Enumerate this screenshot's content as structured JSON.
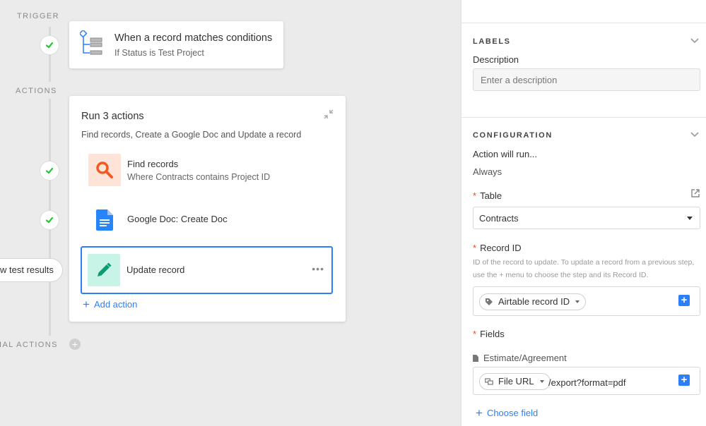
{
  "canvas": {
    "trigger_label": "TRIGGER",
    "actions_label": "ACTIONS",
    "conditional_label": "IAL ACTIONS",
    "trigger": {
      "title": "When a record matches conditions",
      "subtitle": "If Status is Test Project"
    },
    "group": {
      "title": "Run 3 actions",
      "description": "Find records, Create a Google Doc and Update a record",
      "steps": [
        {
          "title": "Find records",
          "subtitle": "Where Contracts contains Project ID",
          "icon": "search-icon"
        },
        {
          "title": "Google Doc: Create Doc",
          "subtitle": "",
          "icon": "google-doc-icon"
        },
        {
          "title": "Update record",
          "subtitle": "",
          "icon": "pencil-icon",
          "selected": true,
          "menu": "•••"
        }
      ],
      "add_action": "Add action"
    },
    "view_results": "w test results",
    "colors": {
      "success": "#20c933",
      "accent": "#2d7ff9",
      "find_bg": "#fde3d8",
      "find_fg": "#f25a1e",
      "update_bg": "#c7f4e6",
      "update_fg": "#0c9b72",
      "doc": "#2684fc"
    }
  },
  "panel": {
    "labels_section": "LABELS",
    "description_label": "Description",
    "description_placeholder": "Enter a description",
    "configuration_section": "CONFIGURATION",
    "action_will_run_label": "Action will run...",
    "action_will_run_value": "Always",
    "required_mark": "*",
    "table_label": "Table",
    "table_value": "Contracts",
    "record_id_label": "Record ID",
    "record_id_help": "ID of the record to update. To update a record from a previous step, use the + menu to choose the step and its Record ID.",
    "record_id_token": "Airtable record ID",
    "fields_label": "Fields",
    "field_name": "Estimate/Agreement",
    "field_token": "File URL",
    "field_suffix": "/export?format=pdf",
    "choose_field": "Choose field"
  }
}
